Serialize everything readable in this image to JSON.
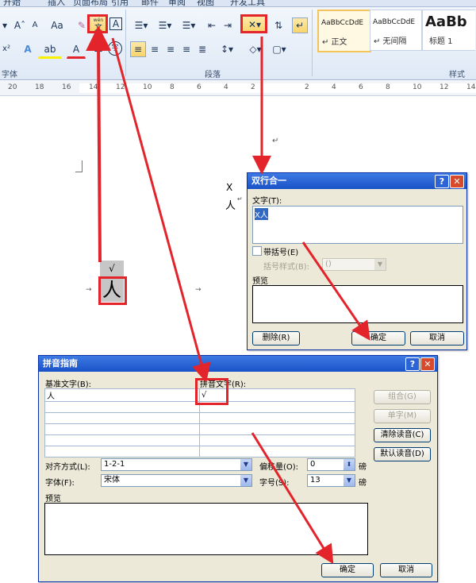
{
  "ribbon": {
    "tabs": [
      "开始",
      "插入",
      "页面布局",
      "引用",
      "邮件",
      "审阅",
      "视图",
      "开发工具"
    ],
    "font_group_label": "字体",
    "paragraph_group_label": "段落",
    "styles_group_label": "样式",
    "font_buttons": {
      "grow": "Aˆ",
      "case": "Aa",
      "pinyin_guide_small": "wén",
      "pinyin_guide_big": "文",
      "char_border": "A",
      "superscript": "x²",
      "text_effect": "A",
      "highlight": "ab",
      "font_color": "A",
      "enclose_char": "字"
    },
    "styles": [
      {
        "preview": "AaBbCcDdE",
        "name": "↵ 正文"
      },
      {
        "preview": "AaBbCcDdE",
        "name": "↵ 无间隔"
      },
      {
        "preview": "AaBb",
        "name": "标题 1"
      }
    ],
    "ruler_marks": [
      "20",
      "18",
      "16",
      "14",
      "12",
      "10",
      "8",
      "6",
      "4",
      "2",
      "",
      "2",
      "4",
      "6",
      "8",
      "10",
      "12",
      "14"
    ]
  },
  "document": {
    "paragraph_mark": "↵",
    "combined_top": "X",
    "combined_bottom": "人",
    "phonetic_top": "√",
    "phonetic_base": "人"
  },
  "combine_dialog": {
    "title": "双行合一",
    "text_label": "文字(T):",
    "text_value": "X人",
    "bracket_label": "带括号(E)",
    "bracket_style_label": "括号样式(B):",
    "bracket_style_value": "()",
    "preview_label": "预览",
    "delete_label": "删除(R)",
    "ok_label": "确定",
    "cancel_label": "取消"
  },
  "pinyin_dialog": {
    "title": "拼音指南",
    "base_header": "基准文字(B):",
    "ruby_header": "拼音文字(R):",
    "rows": [
      {
        "base": "人",
        "ruby": "√"
      },
      {
        "base": "",
        "ruby": ""
      },
      {
        "base": "",
        "ruby": ""
      },
      {
        "base": "",
        "ruby": ""
      },
      {
        "base": "",
        "ruby": ""
      },
      {
        "base": "",
        "ruby": ""
      }
    ],
    "group_label": "组合(G)",
    "single_label": "单字(M)",
    "clear_label": "清除读音(C)",
    "default_label": "默认读音(D)",
    "align_label": "对齐方式(L):",
    "align_value": "1-2-1",
    "offset_label": "偏移量(O):",
    "offset_value": "0",
    "offset_unit": "磅",
    "font_label": "字体(F):",
    "font_value": "宋体",
    "size_label": "字号(S):",
    "size_value": "13",
    "size_unit": "磅",
    "preview_label": "预览",
    "ok_label": "确定",
    "cancel_label": "取消"
  },
  "colors": {
    "annotation_red": "#e3242b",
    "xp_title_blue": "#1a52c8",
    "dialog_face": "#ece9d8"
  }
}
